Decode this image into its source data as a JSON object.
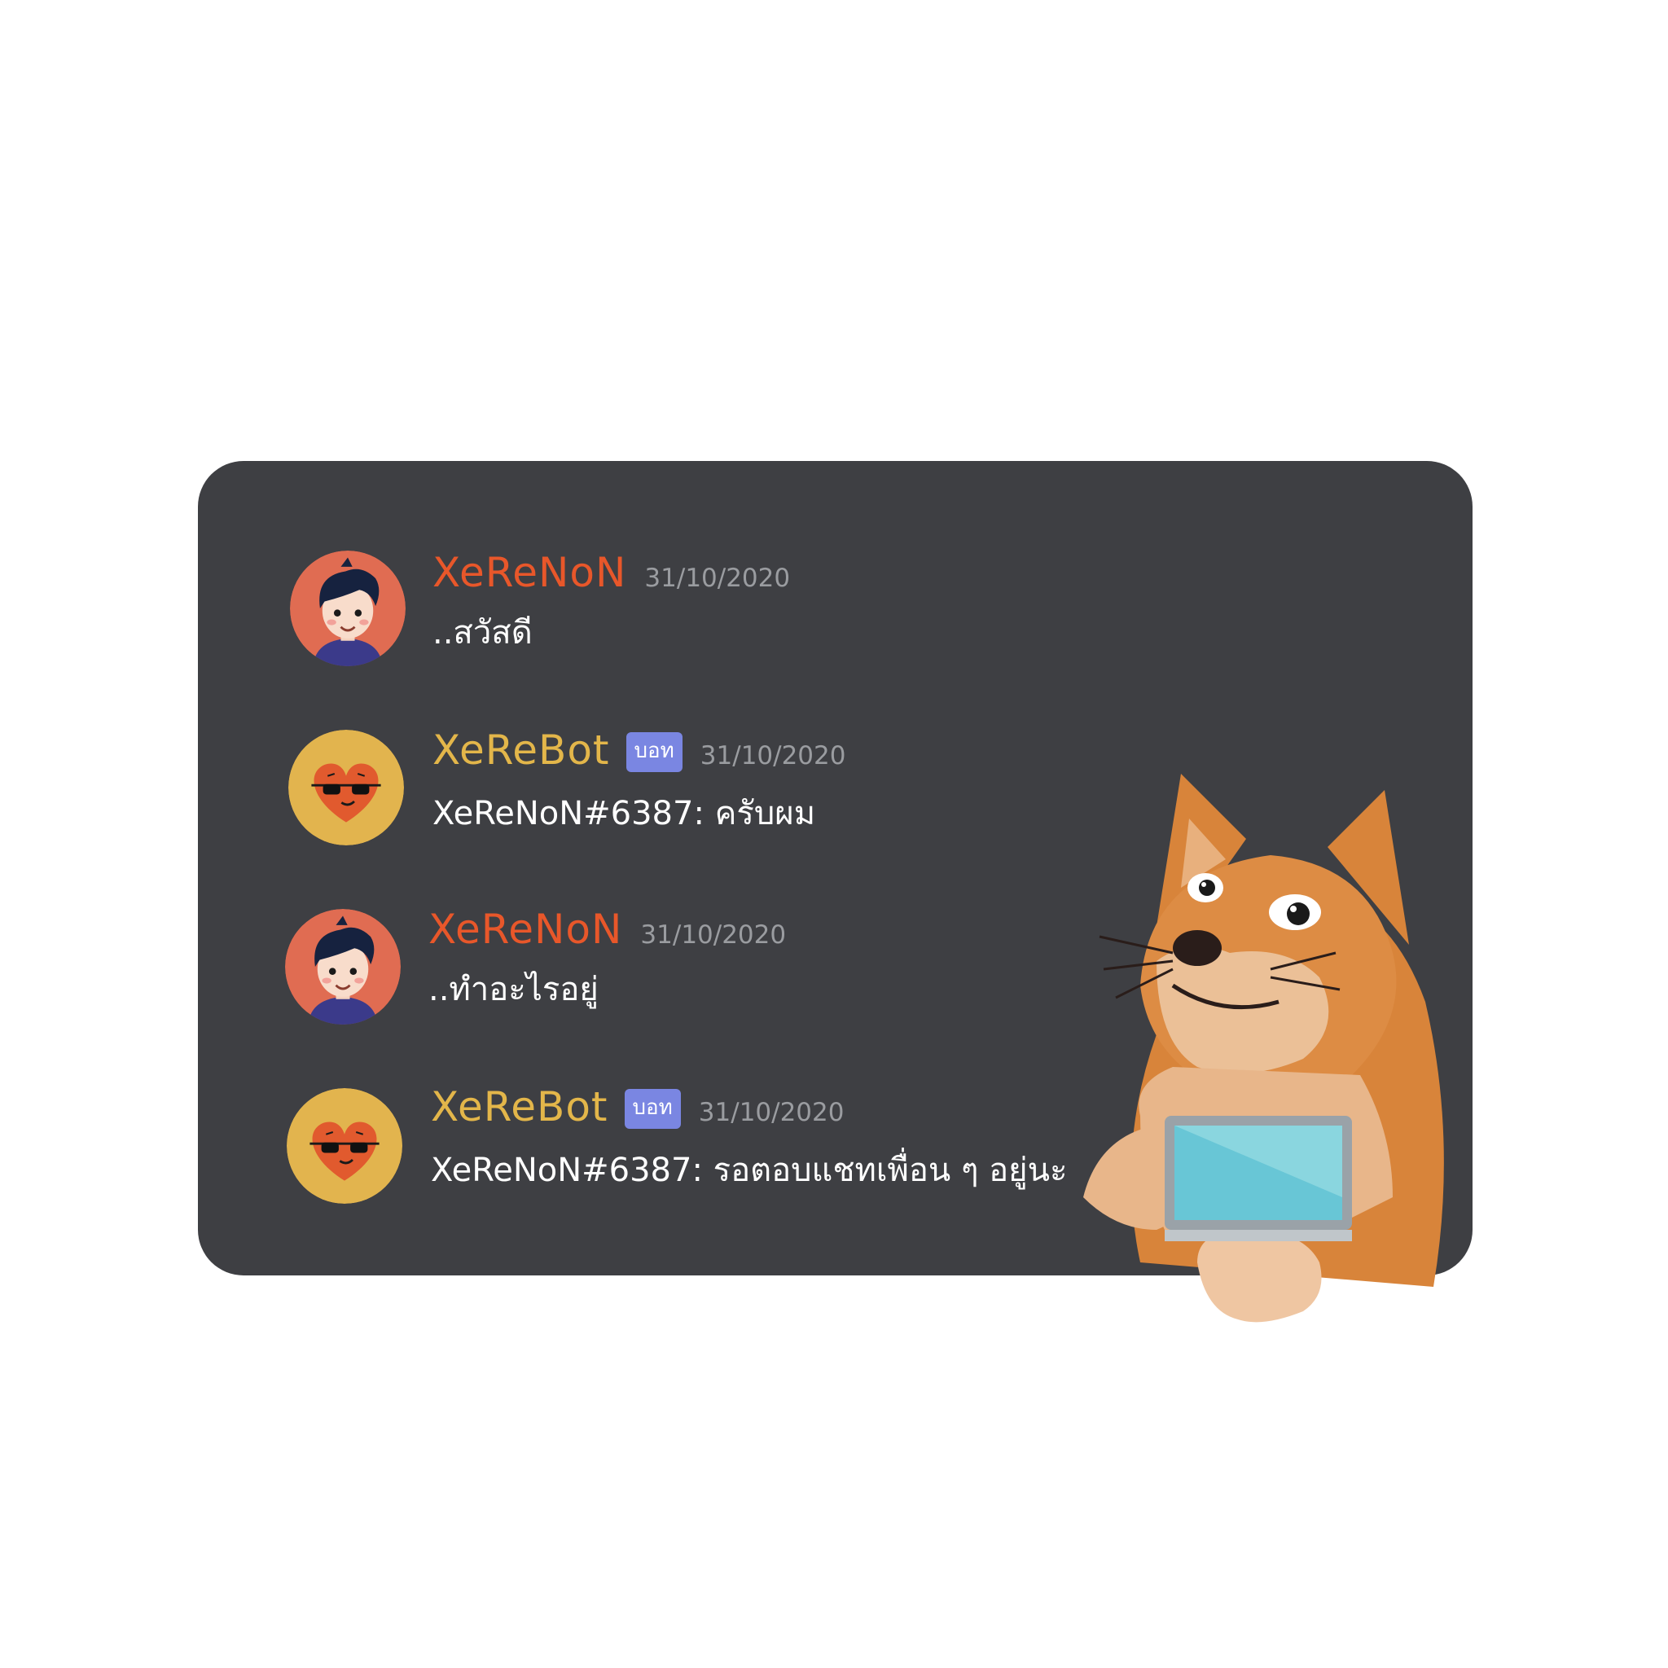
{
  "messages": [
    {
      "author": "XeReNoN",
      "badge": "",
      "timestamp": "31/10/2020",
      "text": "..สวัสดี",
      "avatar": "boy-avatar"
    },
    {
      "author": "XeReBot",
      "badge": "บอท",
      "timestamp": "31/10/2020",
      "text": "XeReNoN#6387: ครับผม",
      "avatar": "heart-sunglasses-avatar"
    },
    {
      "author": "XeReNoN",
      "badge": "",
      "timestamp": "31/10/2020",
      "text": "..ทำอะไรอยู่",
      "avatar": "boy-avatar"
    },
    {
      "author": "XeReBot",
      "badge": "บอท",
      "timestamp": "31/10/2020",
      "text": "XeReNoN#6387: รอตอบแชทเพื่อน ๆ อยู่นะ",
      "avatar": "heart-sunglasses-avatar"
    }
  ],
  "colors": {
    "card_background": "#3e3f43",
    "user_name": "#e8572a",
    "bot_name": "#e3b64a",
    "bot_badge": "#7a86e2",
    "timestamp": "#9a9ca0"
  },
  "decoration": "doge-with-laptop-illustration"
}
